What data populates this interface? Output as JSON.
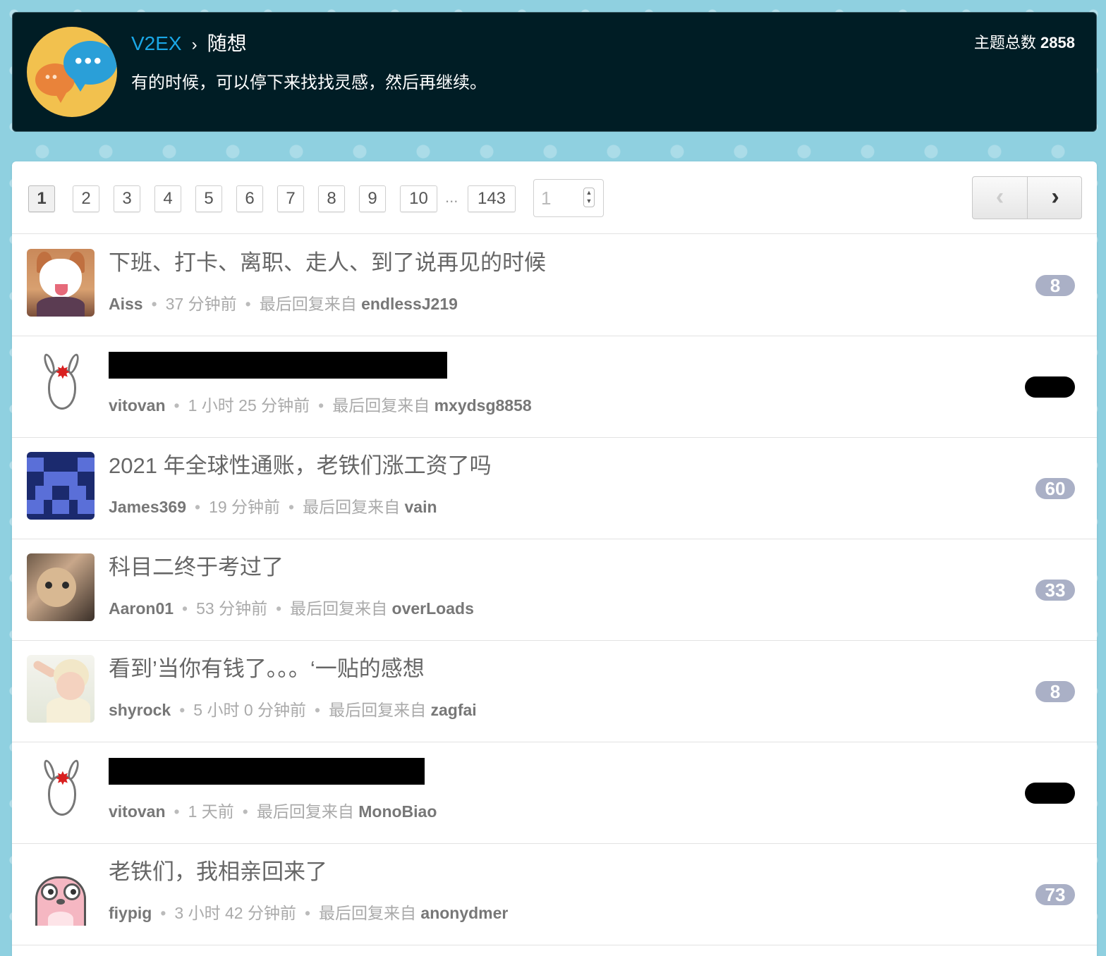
{
  "header": {
    "site_name": "V2EX",
    "separator": "›",
    "node_name": "随想",
    "node_description": "有的时候，可以停下来找找灵感，然后再继续。",
    "topic_count_label": "主题总数",
    "topic_count": "2858"
  },
  "pagination": {
    "pages": [
      "1",
      "2",
      "3",
      "4",
      "5",
      "6",
      "7",
      "8",
      "9",
      "10"
    ],
    "ellipsis": "...",
    "last_page": "143",
    "current_page": "1",
    "jump_input_value": "1",
    "prev_label": "‹",
    "next_label": "›"
  },
  "topics": [
    {
      "title": "下班、打卡、离职、走人、到了说再见的时候",
      "author": "Aiss",
      "time": "37 分钟前",
      "last_reply_label": "最后回复来自",
      "last_reply_user": "endlessJ219",
      "replies": "8",
      "avatar": "corgi-avatar",
      "redacted": false
    },
    {
      "title": "",
      "author": "vitovan",
      "time": "1 小时 25 分钟前",
      "last_reply_label": "最后回复来自",
      "last_reply_user": "mxydsg8858",
      "replies": "",
      "avatar": "donkey-avatar",
      "redacted": true
    },
    {
      "title": "2021 年全球性通账，老铁们涨工资了吗",
      "author": "James369",
      "time": "19 分钟前",
      "last_reply_label": "最后回复来自",
      "last_reply_user": "vain",
      "replies": "60",
      "avatar": "pixel-avatar",
      "redacted": false
    },
    {
      "title": "科目二终于考过了",
      "author": "Aaron01",
      "time": "53 分钟前",
      "last_reply_label": "最后回复来自",
      "last_reply_user": "overLoads",
      "replies": "33",
      "avatar": "cat-avatar",
      "redacted": false
    },
    {
      "title": "看到’当你有钱了。。。‘一贴的感想",
      "author": "shyrock",
      "time": "5 小时 0 分钟前",
      "last_reply_label": "最后回复来自",
      "last_reply_user": "zagfai",
      "replies": "8",
      "avatar": "baby-avatar",
      "redacted": false
    },
    {
      "title": "",
      "author": "vitovan",
      "time": "1 天前",
      "last_reply_label": "最后回复来自",
      "last_reply_user": "MonoBiao",
      "replies": "",
      "avatar": "donkey-avatar",
      "redacted": true
    },
    {
      "title": "老铁们，我相亲回来了",
      "author": "fiypig",
      "time": "3 小时 42 分钟前",
      "last_reply_label": "最后回复来自",
      "last_reply_user": "anonydmer",
      "replies": "73",
      "avatar": "gopher-avatar",
      "redacted": false
    }
  ],
  "meta_dot": "•"
}
